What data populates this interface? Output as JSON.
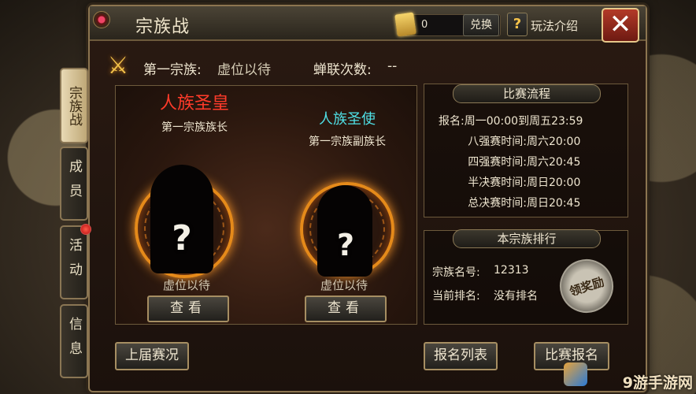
{
  "window": {
    "title": "宗族战"
  },
  "currency": {
    "value": "0",
    "exchange_label": "兑换"
  },
  "help": {
    "icon": "?",
    "label": "玩法介绍"
  },
  "close": {
    "icon": "✕"
  },
  "tabs": [
    {
      "label": "宗族战",
      "active": true
    },
    {
      "label": "成员",
      "active": false
    },
    {
      "label": "活动",
      "active": false,
      "badge": true
    },
    {
      "label": "信息",
      "active": false
    }
  ],
  "info": {
    "first_clan_label": "第一宗族:",
    "first_clan_value": "虚位以待",
    "wins_label": "蝉联次数:",
    "wins_value": "--"
  },
  "ranks": [
    {
      "title": "人族圣皇",
      "subtitle": "第一宗族族长",
      "status": "虚位以待",
      "button": "查看",
      "title_color": "#ff3b2a"
    },
    {
      "title": "人族圣使",
      "subtitle": "第一宗族副族长",
      "status": "虚位以待",
      "button": "查看",
      "title_color": "#4fe0e6"
    }
  ],
  "schedule": {
    "header": "比赛流程",
    "rows": [
      {
        "label": "报名:",
        "value": "周一00:00到周五23:59"
      },
      {
        "label": "八强赛时间:",
        "value": "周六20:00"
      },
      {
        "label": "四强赛时间:",
        "value": "周六20:45"
      },
      {
        "label": "半决赛时间:",
        "value": "周日20:00"
      },
      {
        "label": "总决赛时间:",
        "value": "周日20:45"
      }
    ]
  },
  "clan_rank": {
    "header": "本宗族排行",
    "name_label": "宗族名号:",
    "name_value": "12313",
    "rank_label": "当前排名:",
    "rank_value": "没有排名",
    "reward_label": "领奖励"
  },
  "bottom": {
    "last_match": "上届赛况",
    "signup_list": "报名列表",
    "signup": "比赛报名"
  },
  "watermark": "9游手游网"
}
